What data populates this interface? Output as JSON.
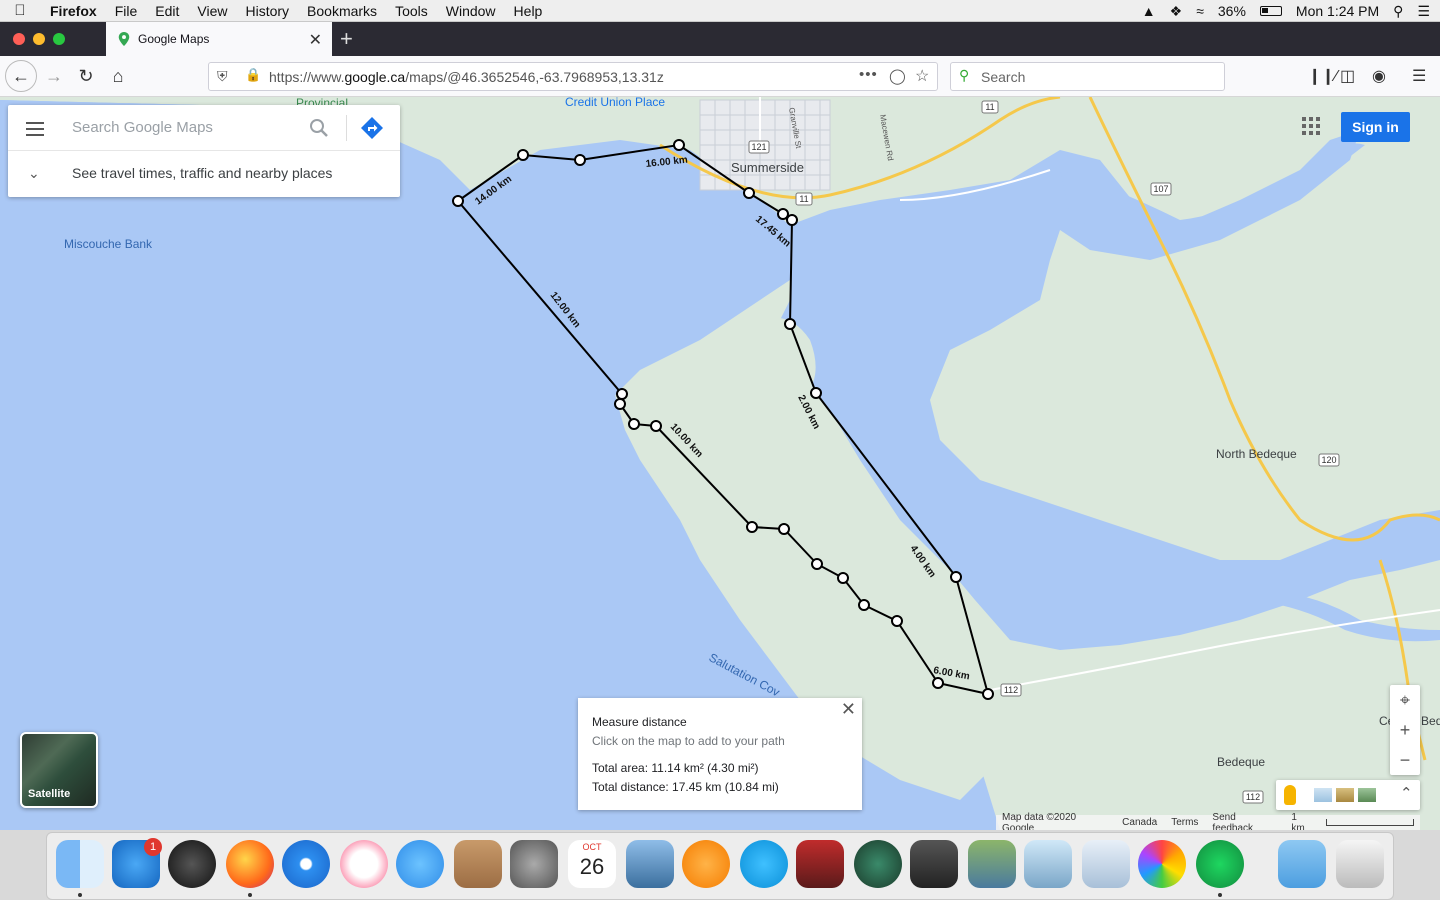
{
  "menubar": {
    "app_name": "Firefox",
    "menus": [
      "File",
      "Edit",
      "View",
      "History",
      "Bookmarks",
      "Tools",
      "Window",
      "Help"
    ],
    "battery": "36%",
    "clock": "Mon 1:24 PM"
  },
  "browser": {
    "tab_title": "Google Maps",
    "url_prefix": "https://www.",
    "url_domain": "google.ca",
    "url_rest": "/maps/@46.3652546,-63.7968953,13.31z",
    "search_placeholder": "Search"
  },
  "maps": {
    "search_placeholder": "Search Google Maps",
    "travel_text": "See travel times, traffic and nearby places",
    "sign_in": "Sign in",
    "satellite_label": "Satellite",
    "labels": {
      "provincial": "Provincial",
      "credit_union": "Credit Union Place",
      "summerside": "Summerside",
      "miscouche": "Miscouche Bank",
      "north_bedeque": "North Bedeque",
      "salutation": "Salutation Cov",
      "central_bedeque": "Central Bedeque",
      "bedeque": "Bedeque",
      "granville": "Granville St",
      "macewen": "Macewen Rd"
    },
    "route_shields": [
      "11",
      "121",
      "11",
      "107",
      "120",
      "112",
      "112"
    ],
    "segment_labels": [
      "14.00 km",
      "16.00 km",
      "17.45 km",
      "12.00 km",
      "10.00 km",
      "2.00 km",
      "4.00 km",
      "6.00 km"
    ],
    "measure": {
      "title": "Measure distance",
      "hint": "Click on the map to add to your path",
      "area": "Total area: 11.14 km² (4.30 mi²)",
      "distance": "Total distance: 17.45 km (10.84 mi)"
    },
    "attribution": {
      "map_data": "Map data ©2020 Google",
      "country": "Canada",
      "terms": "Terms",
      "feedback": "Send feedback",
      "scale": "1 km"
    }
  },
  "dock": {
    "apps": [
      "Finder",
      "App Store",
      "Dashboard",
      "Firefox",
      "Safari",
      "iTunes",
      "Messages",
      "Contacts",
      "System Preferences",
      "Calendar",
      "Preview",
      "iBooks",
      "Skype",
      "Photo Booth",
      "Time Machine",
      "Image Capture",
      "Photo Theater",
      "iPhoto",
      "Preview",
      "Photos",
      "Spotify",
      "Downloads",
      "Trash"
    ],
    "app_store_badge": "1",
    "calendar_month": "OCT",
    "calendar_day": "26"
  }
}
